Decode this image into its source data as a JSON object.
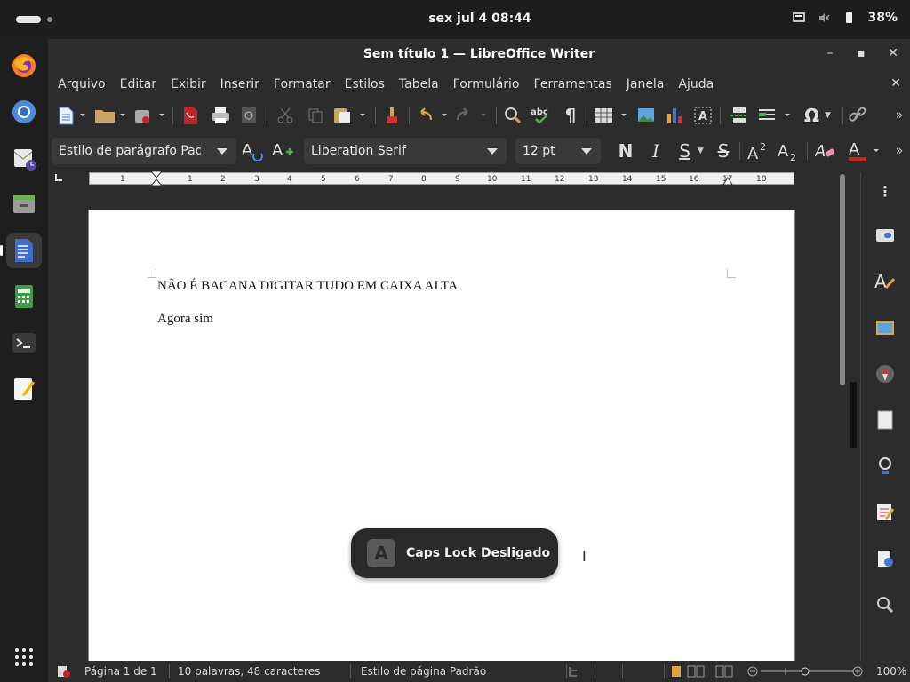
{
  "topbar": {
    "clock": "sex jul 4  08:44",
    "battery": "38%"
  },
  "dock": {
    "apps": [
      {
        "name": "firefox-icon"
      },
      {
        "name": "chromium-icon"
      },
      {
        "name": "mail-icon"
      },
      {
        "name": "files-icon"
      },
      {
        "name": "writer-icon"
      },
      {
        "name": "calc-icon"
      },
      {
        "name": "terminal-icon"
      },
      {
        "name": "text-editor-icon"
      }
    ]
  },
  "window": {
    "title": "Sem título 1 — LibreOffice Writer",
    "menu": [
      "Arquivo",
      "Editar",
      "Exibir",
      "Inserir",
      "Formatar",
      "Estilos",
      "Tabela",
      "Formulário",
      "Ferramentas",
      "Janela",
      "Ajuda"
    ]
  },
  "format": {
    "paragraph_style": "Estilo de parágrafo Padrão",
    "font_name": "Liberation Serif",
    "font_size": "12 pt",
    "bold": "N",
    "italic": "I",
    "underline": "S",
    "strike": "S"
  },
  "ruler": {
    "ticks": [
      "1",
      "1",
      "2",
      "3",
      "4",
      "5",
      "6",
      "7",
      "8",
      "9",
      "10",
      "11",
      "12",
      "13",
      "14",
      "15",
      "16",
      "17",
      "18"
    ]
  },
  "document": {
    "paragraphs": [
      "NÃO É BACANA DIGITAR TUDO EM CAIXA ALTA",
      "Agora sim"
    ]
  },
  "status": {
    "page": "Página 1 de 1",
    "words": "10 palavras, 48 caracteres",
    "page_style": "Estilo de página Padrão",
    "zoom": "100%"
  },
  "osd": {
    "key": "A",
    "message": "Caps Lock Desligado"
  },
  "colors": {
    "accent_red": "#cc2222",
    "dock_bg": "#1e1e1e",
    "panel_bg": "#2c2c2c"
  }
}
